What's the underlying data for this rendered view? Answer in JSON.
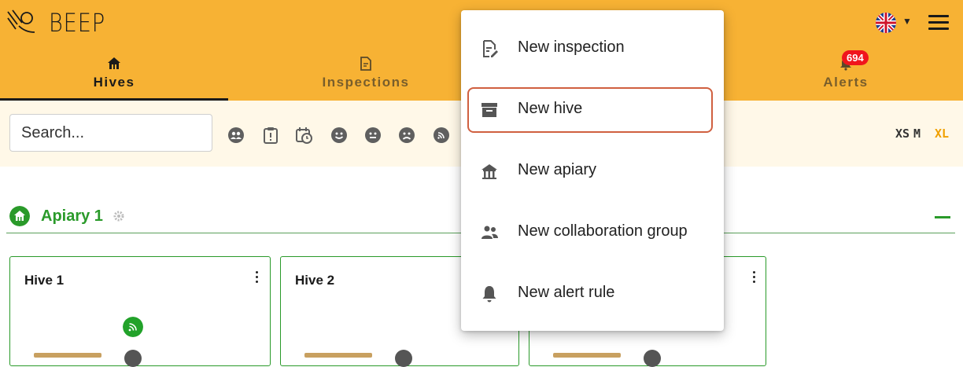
{
  "header": {
    "app_name": "BEEP",
    "language": "English",
    "tabs": [
      {
        "label": "Hives",
        "icon": "home-icon",
        "active": true
      },
      {
        "label": "Inspections",
        "icon": "inspection-icon",
        "active": false
      },
      {
        "label": "Alerts",
        "icon": "bell-icon",
        "active": false
      }
    ],
    "alerts_badge": "694"
  },
  "filterbar": {
    "search_placeholder": "Search...",
    "filter_icons": [
      "group-icon",
      "clipboard-alert-icon",
      "calendar-clock-icon",
      "smiley-happy-icon",
      "smiley-neutral-icon",
      "smiley-sad-icon",
      "sensor-icon"
    ],
    "sizes": [
      "XS",
      "M",
      "XL"
    ],
    "active_size": "XL"
  },
  "apiary": {
    "name": "Apiary 1",
    "hives": [
      {
        "name": "Hive 1",
        "has_sensor": true
      },
      {
        "name": "Hive 2",
        "has_sensor": false
      },
      {
        "name": "",
        "has_sensor": false
      }
    ]
  },
  "menu": {
    "items": [
      {
        "label": "New inspection",
        "icon": "inspection-edit-icon",
        "highlighted": false
      },
      {
        "label": "New hive",
        "icon": "hive-box-icon",
        "highlighted": true
      },
      {
        "label": "New apiary",
        "icon": "apiary-icon",
        "highlighted": false
      },
      {
        "label": "New collaboration group",
        "icon": "group-icon",
        "highlighted": false
      },
      {
        "label": "New alert rule",
        "icon": "bell-icon",
        "highlighted": false
      }
    ]
  },
  "colors": {
    "header_bg": "#f7b234",
    "filter_bg": "#fff8e8",
    "apiary_green": "#2a9a2a",
    "badge_red": "#f0151c",
    "active_size": "#f0a000",
    "highlight_border": "#d06040"
  }
}
